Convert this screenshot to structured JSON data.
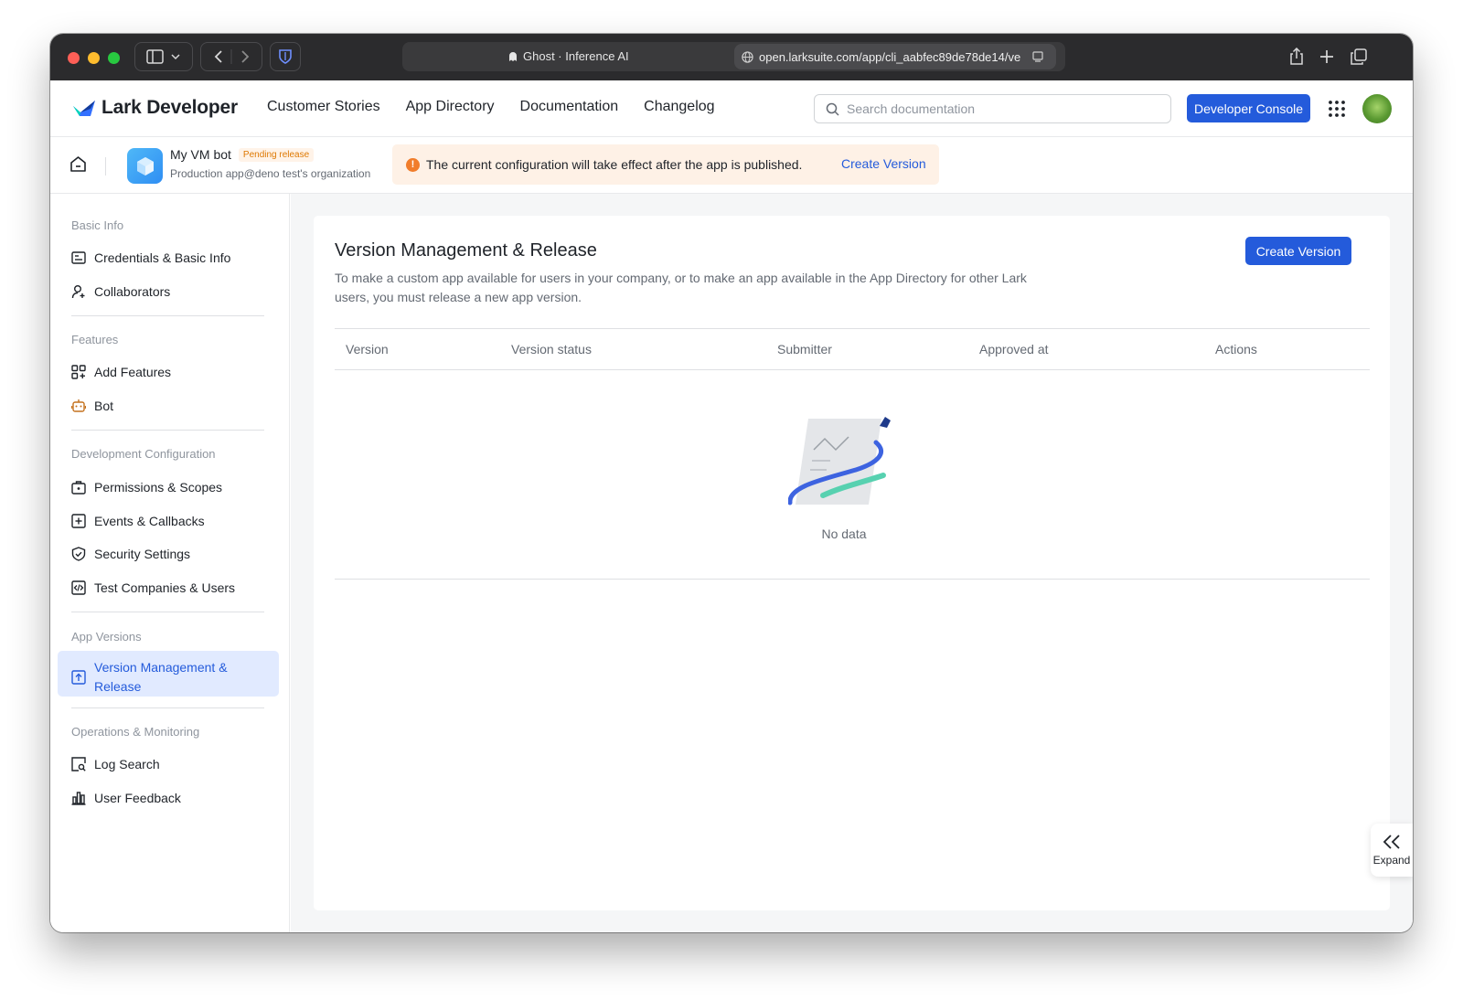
{
  "browser": {
    "tab_title": "Ghost · Inference AI",
    "url": "open.larksuite.com/app/cli_aabfec89de78de14/ve"
  },
  "nav": {
    "logo_text": "Lark Developer",
    "links": [
      "Customer Stories",
      "App Directory",
      "Documentation",
      "Changelog"
    ],
    "search_placeholder": "Search documentation",
    "console_button": "Developer Console"
  },
  "app": {
    "name": "My VM bot",
    "badge": "Pending release",
    "org": "Production app@deno test's organization",
    "notice": "The current configuration will take effect after the app is published.",
    "notice_link": "Create Version"
  },
  "sidebar": {
    "groups": [
      {
        "title": "Basic Info",
        "items": [
          "Credentials & Basic Info",
          "Collaborators"
        ]
      },
      {
        "title": "Features",
        "items": [
          "Add Features",
          "Bot"
        ]
      },
      {
        "title": "Development Configuration",
        "items": [
          "Permissions & Scopes",
          "Events & Callbacks",
          "Security Settings",
          "Test Companies & Users"
        ]
      },
      {
        "title": "App Versions",
        "items": [
          "Version Management & Release"
        ]
      },
      {
        "title": "Operations & Monitoring",
        "items": [
          "Log Search",
          "User Feedback"
        ]
      }
    ]
  },
  "main": {
    "title": "Version Management & Release",
    "description": "To make a custom app available for users in your company, or to make an app available in the App Directory for other Lark users, you must release a new app version.",
    "create_button": "Create Version",
    "columns": [
      "Version",
      "Version status",
      "Submitter",
      "Approved at",
      "Actions"
    ],
    "empty_text": "No data"
  },
  "expand_label": "Expand",
  "colors": {
    "accent": "#245bdb",
    "active_bg": "#e1eaff",
    "notice_bg": "#fef1e6",
    "notice_icon": "#f17d2b",
    "badge_text": "#de7802"
  }
}
